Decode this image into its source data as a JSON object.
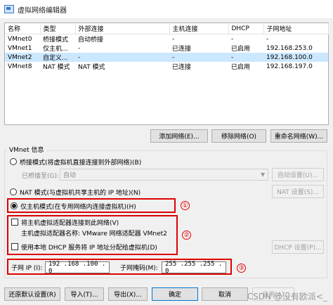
{
  "window": {
    "title": "虚拟网络编辑器"
  },
  "table": {
    "columns": [
      "名称",
      "类型",
      "外部连接",
      "主机连接",
      "DHCP",
      "子网地址"
    ],
    "rows": [
      {
        "name": "VMnet0",
        "type": "桥接模式",
        "external": "自动桥接",
        "host": "-",
        "dhcp": "-",
        "subnet": "-"
      },
      {
        "name": "VMnet1",
        "type": "仅主机...",
        "external": "-",
        "host": "已连接",
        "dhcp": "已启用",
        "subnet": "192.168.253.0"
      },
      {
        "name": "VMnet2",
        "type": "自定义...",
        "external": "-",
        "host": "-",
        "dhcp": "-",
        "subnet": "192.168.100.0"
      },
      {
        "name": "VMnet8",
        "type": "NAT 模式",
        "external": "NAT 模式",
        "host": "已连接",
        "dhcp": "已启用",
        "subnet": "192.168.197.0"
      }
    ],
    "selected_row": 2
  },
  "network_buttons": {
    "add": "添加网络(E)...",
    "remove": "移除网络(O)",
    "rename": "重命名网络(W)..."
  },
  "vmnet_info": {
    "title": "VMnet 信息",
    "bridged_radio": "桥接模式(将虚拟机直接连接到外部网络)(B)",
    "bridged_to_label": "已桥接至(G):",
    "bridged_to_value": "自动",
    "auto_settings": "自动设置(U)...",
    "nat_radio": "NAT 模式(与虚拟机共享主机的 IP 地址)(N)",
    "nat_settings": "NAT 设置(S)...",
    "hostonly_radio": "仅主机模式(在专用网络内连接虚拟机)(H)",
    "connect_adapter": "将主机虚拟适配器连接到此网络(V)",
    "adapter_name": "主机虚拟适配器名称: VMware 网络适配器 VMnet2",
    "use_dhcp": "使用本地 DHCP 服务将 IP 地址分配给虚拟机(D)",
    "dhcp_settings": "DHCP 设置(P)...",
    "subnet_ip_label": "子网 IP (I):",
    "subnet_ip": "192 .168 .100 . 0",
    "subnet_mask_label": "子网掩码(M):",
    "subnet_mask": "255 .255 .255 . 0",
    "selected_mode": "hostonly"
  },
  "annotations": {
    "m1": "①",
    "m2": "②",
    "m3": "③",
    "color": "#e00000"
  },
  "footer": {
    "restore": "还原默认设置(R)",
    "import": "导入(T)...",
    "export": "导出(X)...",
    "ok": "确定",
    "cancel": "取消",
    "apply": "应用(A)"
  },
  "watermark": "CSDN @没有欧派<_"
}
